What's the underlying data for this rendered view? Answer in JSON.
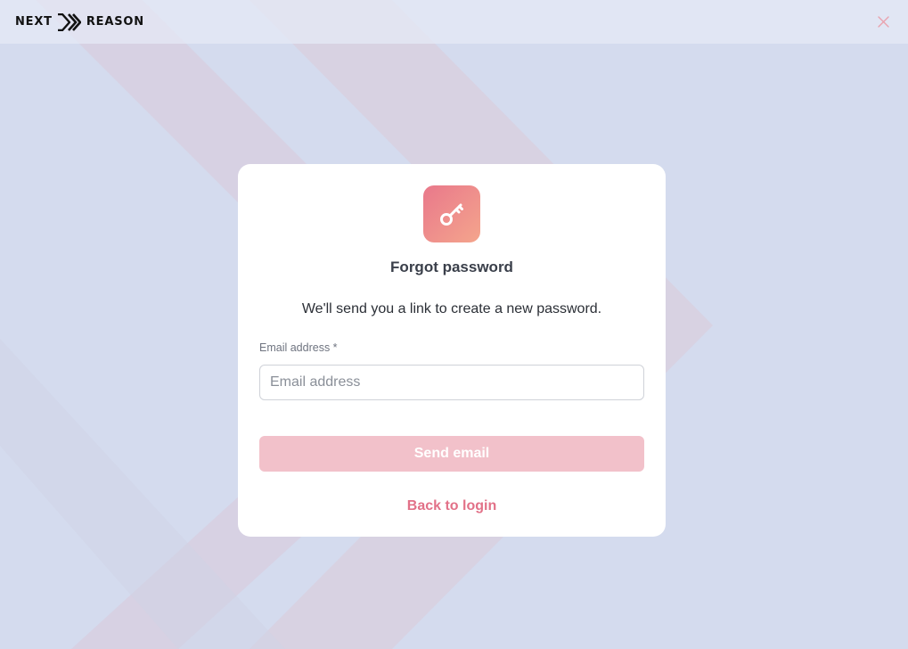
{
  "header": {
    "logo_left": "NEXT",
    "logo_right": "REASON",
    "close_icon": "close-icon"
  },
  "card": {
    "icon": "key-icon",
    "title": "Forgot password",
    "subtitle": "We'll send you a link to create a new password.",
    "email_label": "Email address *",
    "email_placeholder": "Email address",
    "email_value": "",
    "send_button_label": "Send email",
    "back_link_label": "Back to login"
  },
  "colors": {
    "accent": "#e27188",
    "button_disabled": "#f2c1ca",
    "background": "#d4dbee"
  }
}
